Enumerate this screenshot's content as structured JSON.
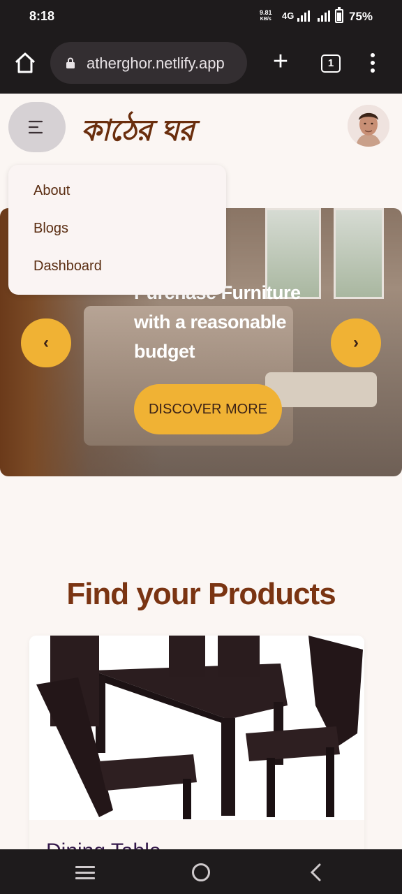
{
  "status": {
    "time": "8:18",
    "speed_value": "9.81",
    "speed_unit": "KB/s",
    "network": "4G",
    "battery": "75%",
    "battery_level": 0.75
  },
  "browser": {
    "url": "atherghor.netlify.app",
    "tab_count": "1"
  },
  "header": {
    "logo_text": "কাঠের ঘর"
  },
  "dropdown": {
    "items": [
      "About",
      "Blogs",
      "Dashboard"
    ]
  },
  "hero": {
    "title": "Purchase Furniture with a reasonable budget",
    "cta": "DISCOVER MORE",
    "prev": "‹",
    "next": "›"
  },
  "products": {
    "section_title": "Find your Products",
    "items": [
      {
        "name": "Dining Table"
      }
    ]
  },
  "colors": {
    "accent": "#f0b234",
    "brand_brown": "#7a3412",
    "chrome": "#1e1b1c"
  }
}
